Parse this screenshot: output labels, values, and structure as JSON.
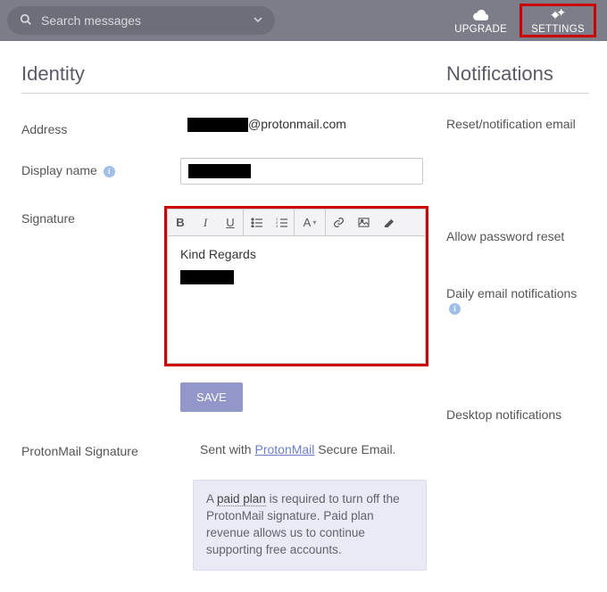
{
  "topbar": {
    "search_placeholder": "Search messages",
    "upgrade": "UPGRADE",
    "settings": "SETTINGS"
  },
  "identity": {
    "heading": "Identity",
    "address_label": "Address",
    "address_domain": "@protonmail.com",
    "display_name_label": "Display name",
    "signature_label": "Signature",
    "signature_text": "Kind Regards",
    "save": "SAVE",
    "pm_sig_label": "ProtonMail Signature",
    "pm_sig_prefix": "Sent with ",
    "pm_sig_link": "ProtonMail",
    "pm_sig_suffix": " Secure Email.",
    "notice_a": "A ",
    "notice_paid": "paid plan",
    "notice_rest": " is required to turn off the ProtonMail signature. Paid plan revenue allows us to continue supporting free accounts."
  },
  "notifications": {
    "heading": "Notifications",
    "reset": "Reset/notification email",
    "allow_reset": "Allow password reset",
    "daily": "Daily email notifications",
    "desktop": "Desktop notifications"
  }
}
